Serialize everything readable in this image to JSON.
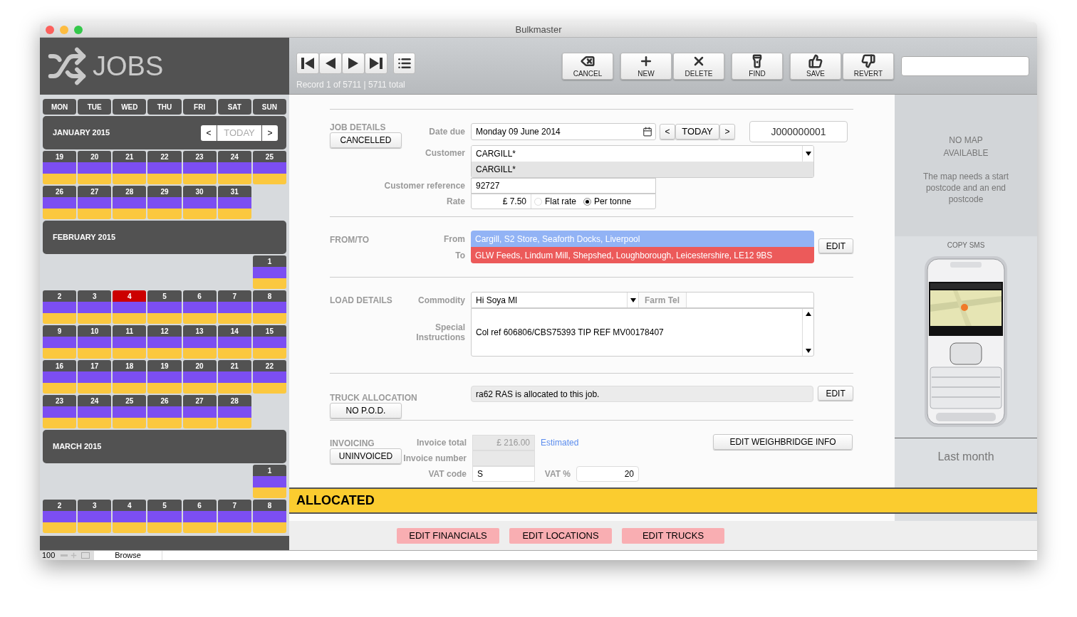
{
  "window": {
    "title": "Bulkmaster"
  },
  "sidebar": {
    "title": "JOBS",
    "weekdays": [
      "MON",
      "TUE",
      "WED",
      "THU",
      "FRI",
      "SAT",
      "SUN"
    ],
    "months": [
      {
        "title": "JANUARY 2015",
        "nav": {
          "prev": "<",
          "today": "TODAY",
          "next": ">"
        },
        "weeks": [
          [
            {
              "label": "19",
              "highlighted": false
            },
            {
              "label": "20",
              "highlighted": false
            },
            {
              "label": "21",
              "highlighted": false
            },
            {
              "label": "22",
              "highlighted": false
            },
            {
              "label": "23",
              "highlighted": false
            },
            {
              "label": "24",
              "highlighted": false
            },
            {
              "label": "25",
              "highlighted": false
            }
          ],
          [
            {
              "label": "26",
              "highlighted": false
            },
            {
              "label": "27",
              "highlighted": false
            },
            {
              "label": "28",
              "highlighted": false
            },
            {
              "label": "29",
              "highlighted": false
            },
            {
              "label": "30",
              "highlighted": false
            },
            {
              "label": "31",
              "highlighted": false
            }
          ]
        ]
      },
      {
        "title": "FEBRUARY 2015",
        "weeks": [
          [
            {
              "label": "1",
              "highlighted": false
            }
          ],
          [
            {
              "label": "2",
              "highlighted": false
            },
            {
              "label": "3",
              "highlighted": false
            },
            {
              "label": "4",
              "highlighted": true
            },
            {
              "label": "5",
              "highlighted": false
            },
            {
              "label": "6",
              "highlighted": false
            },
            {
              "label": "7",
              "highlighted": false
            },
            {
              "label": "8",
              "highlighted": false
            }
          ],
          [
            {
              "label": "9",
              "highlighted": false
            },
            {
              "label": "10",
              "highlighted": false
            },
            {
              "label": "11",
              "highlighted": false
            },
            {
              "label": "12",
              "highlighted": false
            },
            {
              "label": "13",
              "highlighted": false
            },
            {
              "label": "14",
              "highlighted": false
            },
            {
              "label": "15",
              "highlighted": false
            }
          ],
          [
            {
              "label": "16",
              "highlighted": false
            },
            {
              "label": "17",
              "highlighted": false
            },
            {
              "label": "18",
              "highlighted": false
            },
            {
              "label": "19",
              "highlighted": false
            },
            {
              "label": "20",
              "highlighted": false
            },
            {
              "label": "21",
              "highlighted": false
            },
            {
              "label": "22",
              "highlighted": false
            }
          ],
          [
            {
              "label": "23",
              "highlighted": false
            },
            {
              "label": "24",
              "highlighted": false
            },
            {
              "label": "25",
              "highlighted": false
            },
            {
              "label": "26",
              "highlighted": false
            },
            {
              "label": "27",
              "highlighted": false
            },
            {
              "label": "28",
              "highlighted": false
            }
          ]
        ]
      },
      {
        "title": "MARCH 2015",
        "weeks": [
          [
            {
              "label": "1",
              "highlighted": false
            }
          ],
          [
            {
              "label": "2",
              "highlighted": false
            },
            {
              "label": "3",
              "highlighted": false
            },
            {
              "label": "4",
              "highlighted": false
            },
            {
              "label": "5",
              "highlighted": false
            },
            {
              "label": "6",
              "highlighted": false
            },
            {
              "label": "7",
              "highlighted": false
            },
            {
              "label": "8",
              "highlighted": false
            }
          ]
        ]
      }
    ]
  },
  "toolbar": {
    "record_info": "Record 1 of 5711 | 5711 total",
    "buttons": [
      {
        "label": "CANCEL"
      },
      {
        "label": "NEW"
      },
      {
        "label": "DELETE"
      },
      {
        "label": "FIND"
      },
      {
        "label": "SAVE"
      },
      {
        "label": "REVERT"
      }
    ]
  },
  "job_details": {
    "title": "JOB DETAILS",
    "status_button": "CANCELLED",
    "date_label": "Date due",
    "date": "Monday 09 June 2014",
    "date_prev": "<",
    "date_today": "TODAY",
    "date_next": ">",
    "job_number": "J000000001",
    "customer_label": "Customer",
    "customer": "CARGILL*",
    "customer_suggestion": "CARGILL*",
    "reference_label": "Customer reference",
    "reference": "92727",
    "rate_label": "Rate",
    "rate": "£ 7.50",
    "rate_options": [
      {
        "label": "Flat rate",
        "selected": false
      },
      {
        "label": "Per tonne",
        "selected": true
      }
    ]
  },
  "from_to": {
    "title": "FROM/TO",
    "from_label": "From",
    "from": "Cargill, S2 Store, Seaforth Docks, Liverpool",
    "to_label": "To",
    "to": "GLW Feeds, Lindum Mill, Shepshed, Loughborough, Leicestershire, LE12 9BS",
    "edit": "EDIT"
  },
  "load_details": {
    "title": "LOAD DETAILS",
    "commodity_label": "Commodity",
    "commodity": "Hi Soya Ml",
    "farm_tel_label": "Farm Tel",
    "instructions_label": "Special Instructions",
    "instructions": "Col ref 606806/CBS75393 TIP REF MV00178407"
  },
  "truck_allocation": {
    "title": "TRUCK ALLOCATION",
    "status_button": "NO P.O.D.",
    "info": "ra62 RAS is allocated to this job.",
    "edit": "EDIT"
  },
  "invoicing": {
    "title": "INVOICING",
    "status_button": "UNINVOICED",
    "total_label": "Invoice total",
    "total": "£ 216.00",
    "estimate": "Estimated",
    "number_label": "Invoice number",
    "vat_code_label": "VAT code",
    "vat_code": "S",
    "vat_pct_label": "VAT %",
    "vat_pct": "20",
    "weighbridge": "EDIT WEIGHBRIDGE INFO"
  },
  "map_panel": {
    "title": "NO MAP AVAILABLE",
    "message": "The map needs a start postcode and an end postcode",
    "sms": "COPY SMS",
    "period": "Last month"
  },
  "status_banner": "ALLOCATED",
  "bottom_buttons": [
    "EDIT FINANCIALS",
    "EDIT LOCATIONS",
    "EDIT TRUCKS"
  ],
  "status_bar": {
    "zoom": "100",
    "mode": "Browse"
  }
}
